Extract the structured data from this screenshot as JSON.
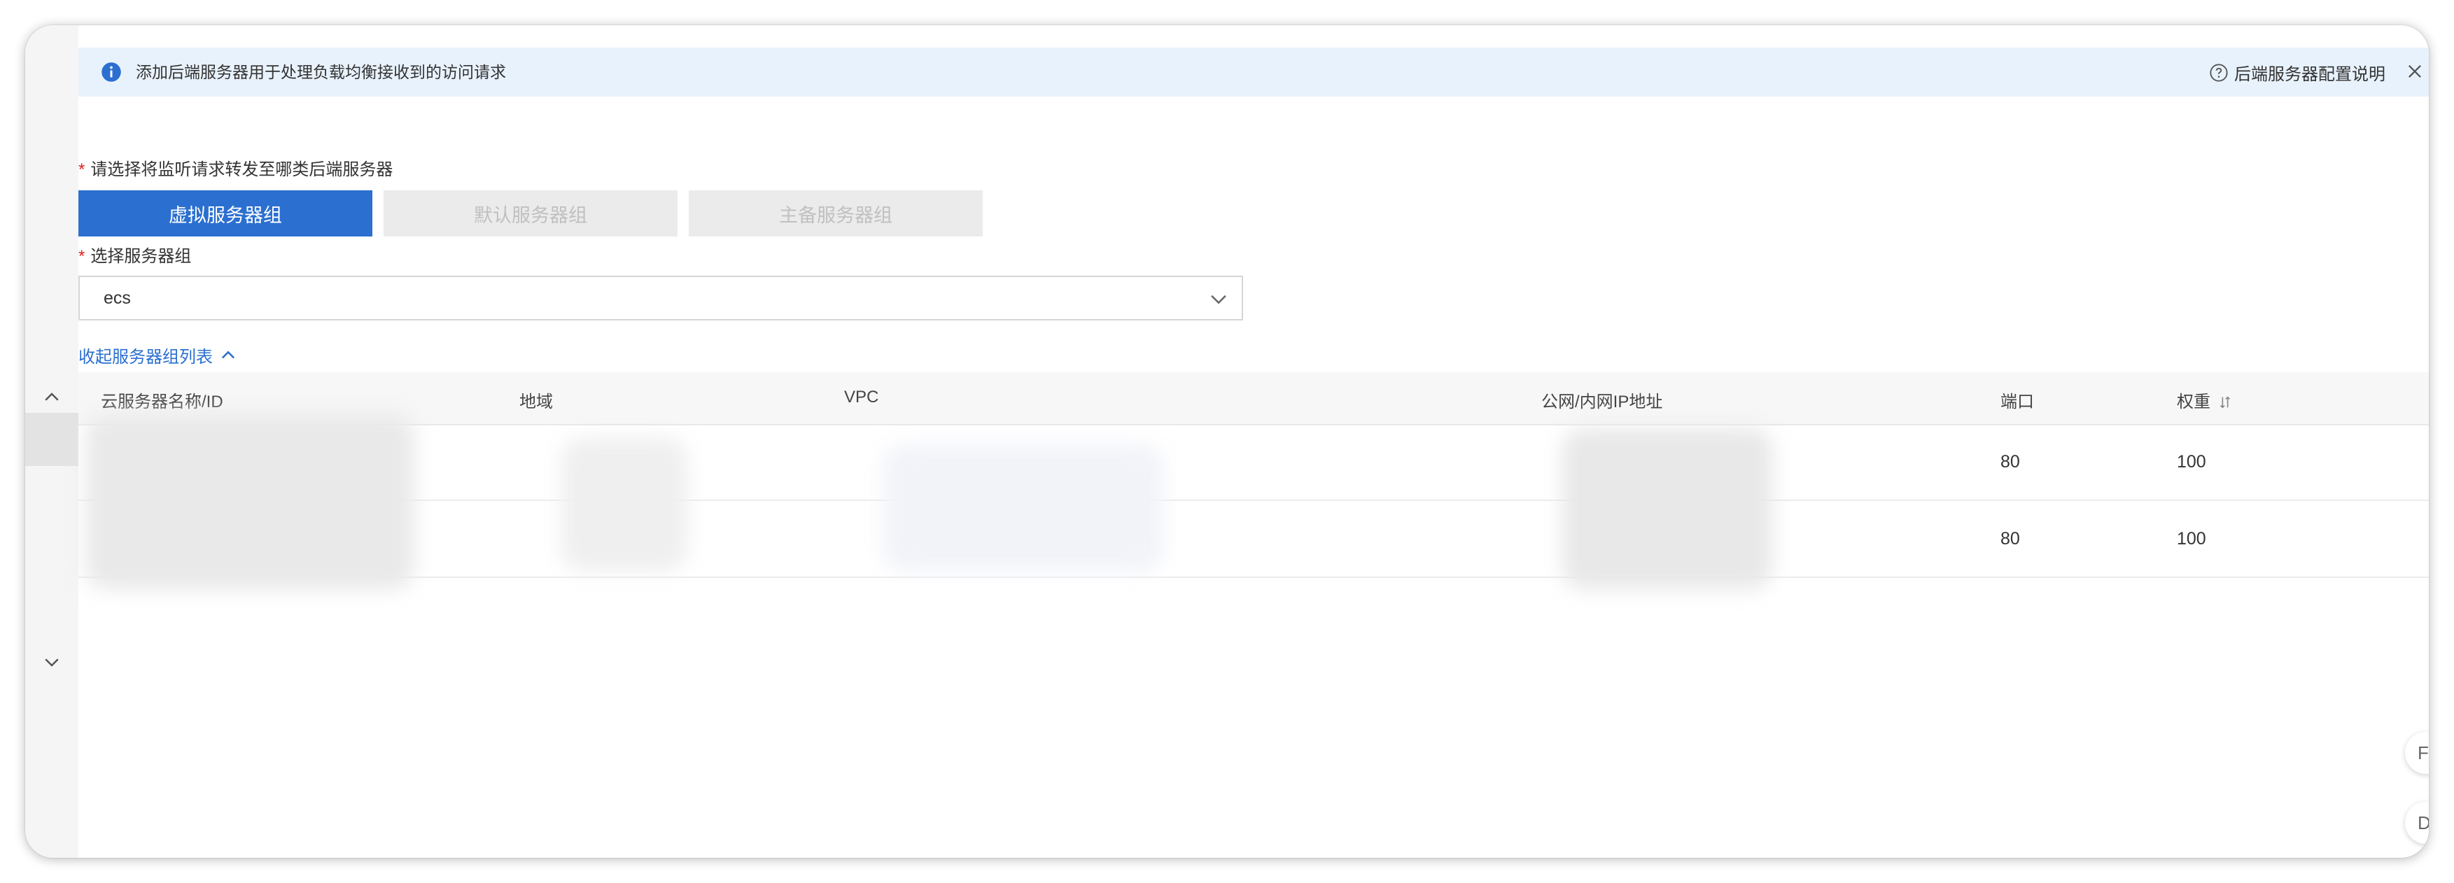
{
  "notice": {
    "text": "添加后端服务器用于处理负载均衡接收到的访问请求",
    "help_link": "后端服务器配置说明"
  },
  "forward_section": {
    "label": "请选择将监听请求转发至哪类后端服务器",
    "required_mark": "*",
    "options": [
      {
        "label": "虚拟服务器组",
        "state": "active"
      },
      {
        "label": "默认服务器组",
        "state": "disabled"
      },
      {
        "label": "主备服务器组",
        "state": "disabled"
      }
    ]
  },
  "group_select": {
    "label": "选择服务器组",
    "required_mark": "*",
    "value": "ecs"
  },
  "collapse_link": "收起服务器组列表",
  "table": {
    "columns": [
      "云服务器名称/ID",
      "地域",
      "VPC",
      "公网/内网IP地址",
      "端口",
      "权重"
    ],
    "rows": [
      {
        "port": "80",
        "weight": "100"
      },
      {
        "port": "80",
        "weight": "100"
      }
    ]
  },
  "edge_buttons": [
    "F",
    "D"
  ],
  "colors": {
    "primary": "#2b6fd0",
    "info_bg": "#e8f2fc",
    "required": "#e02020",
    "disabled_bg": "#ebebeb"
  }
}
